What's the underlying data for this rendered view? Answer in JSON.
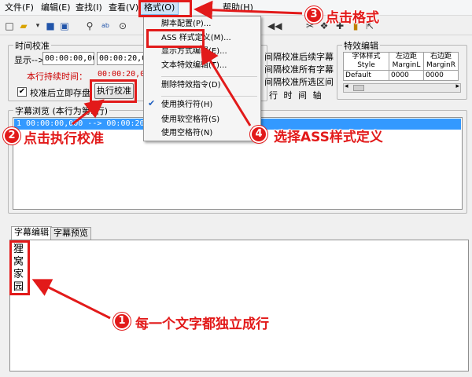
{
  "menu": {
    "file": "文件(F)",
    "edit": "编辑(E)",
    "find": "查找(I)",
    "view": "查看(V)",
    "format": "格式(O)",
    "help": "帮助(H)"
  },
  "toolbar": {
    "icons": [
      "new-file-icon",
      "open-folder-icon",
      "save-icon",
      "save-all-icon",
      "binoculars-icon",
      "find-replace-icon",
      "zoom-icon",
      "back-icon",
      "tool-a-icon",
      "tool-b-icon",
      "tool-c-icon",
      "lock-icon",
      "export-icon"
    ]
  },
  "time_calibration": {
    "title": "时间校准",
    "display_label": "显示-->",
    "start_time": "00:00:00,000",
    "end_time": "00:00:20,00",
    "duration_label": "本行持续时间：",
    "duration_value": "00:00:20,000",
    "autosave_label": "校准后立即存盘",
    "autosave_checked": true,
    "execute_button": "执行校准"
  },
  "calibration_options": {
    "line1": "间隔校准后续字幕",
    "line2": "间隔校准所有字幕",
    "line3": "间隔校准所选区间",
    "line4": "行 时 间 轴"
  },
  "effects_panel": {
    "title": "特效编辑",
    "col_style_top": "字体样式",
    "col_style_bottom": "Style",
    "col_margin_l_top": "左边距",
    "col_margin_l_bottom": "MarginL",
    "col_margin_r_top": "右边距",
    "col_margin_r_bottom": "MarginR",
    "row_style": "Default",
    "row_margin_l": "0000",
    "row_margin_r": "0000"
  },
  "subtitle_browser": {
    "title": "字幕浏览 (本行为第1行)",
    "selected_row": "1 00:00:00,000 --> 00:00:20,00"
  },
  "bottom_tabs": {
    "tab_edit": "字幕编辑",
    "tab_preview": "字幕预览"
  },
  "editor_lines": [
    "狸",
    "窝",
    "家",
    "园"
  ],
  "format_menu": {
    "item_script_config": "脚本配置(P)...",
    "item_ass_style": "ASS 样式定义(M)...",
    "item_display_mode": "显示方式编辑(E)...",
    "item_text_effects": "文本特效编辑(T)...",
    "item_delete_effects": "删除特效指令(D)",
    "item_wrap": "使用换行符(H)",
    "item_soft_space": "使用软空格符(S)",
    "item_space": "使用空格符(N)",
    "wrap_checked": true
  },
  "annotations": {
    "step1_number": "1",
    "step1_text": "每一个文字都独立成行",
    "step2_number": "2",
    "step2_text": "点击执行校准",
    "step3_number": "3",
    "step3_text": "点击格式",
    "step4_number": "4",
    "step4_text": "选择ASS样式定义",
    "color": "#e21a1a"
  }
}
